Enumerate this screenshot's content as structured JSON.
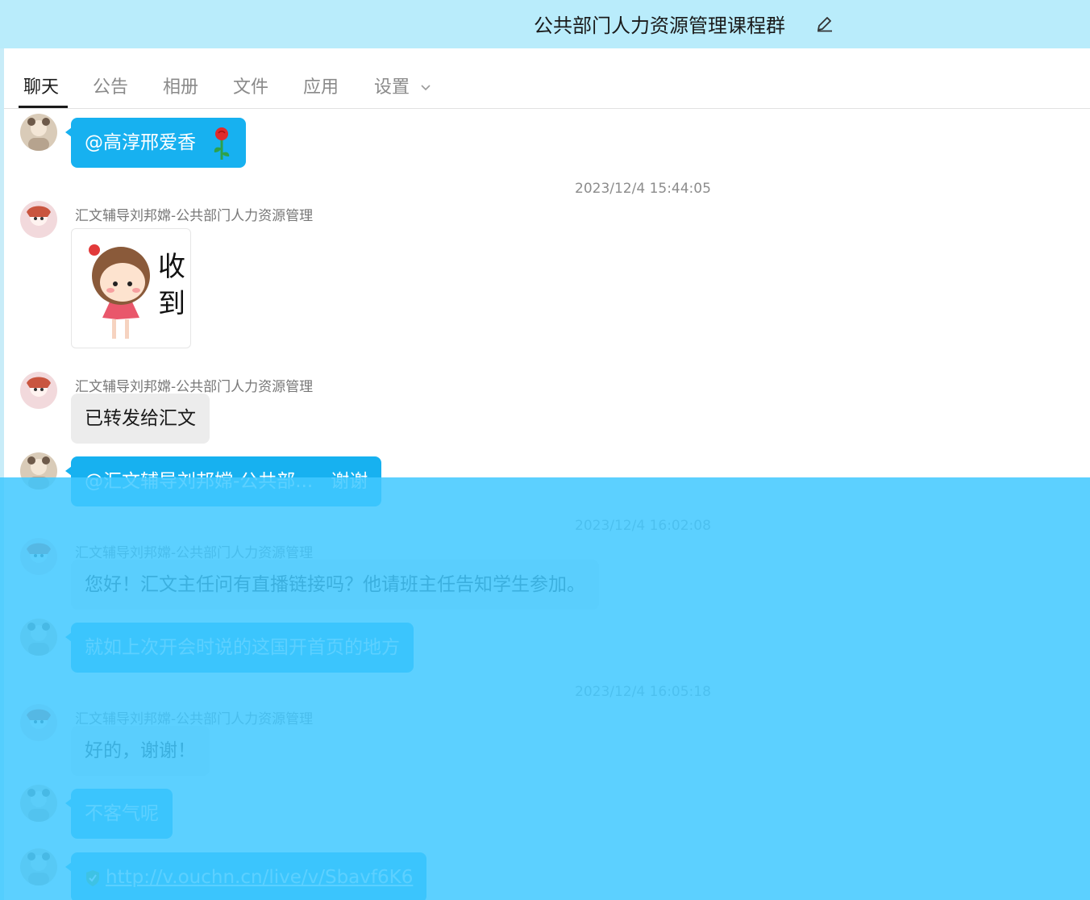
{
  "window": {
    "title": "公共部门人力资源管理课程群",
    "edit_icon": "pencil-icon"
  },
  "tabs": [
    {
      "label": "聊天",
      "active": true
    },
    {
      "label": "公告"
    },
    {
      "label": "相册"
    },
    {
      "label": "文件"
    },
    {
      "label": "应用"
    },
    {
      "label": "设置",
      "has_dropdown": true
    }
  ],
  "messages": {
    "m1": {
      "text": "@高淳邢爱香",
      "emoji": "rose-icon"
    },
    "t1": "2023/12/4 15:44:05",
    "m2": {
      "sender": "汇文辅导刘邦嫦-公共部门人力资源管理",
      "sticker_text": "收到"
    },
    "m3": {
      "sender": "汇文辅导刘邦嫦-公共部门人力资源管理",
      "text": "已转发给汇文"
    },
    "m4": {
      "mention": "@汇文辅导刘邦嫦-公共部...",
      "text": "谢谢"
    },
    "t2": "2023/12/4 16:02:08",
    "m5": {
      "sender": "汇文辅导刘邦嫦-公共部门人力资源管理",
      "text": "您好！汇文主任问有直播链接吗？他请班主任告知学生参加。"
    },
    "m6": {
      "text": "就如上次开会时说的这国开首页的地方"
    },
    "t3": "2023/12/4 16:05:18",
    "m7": {
      "sender": "汇文辅导刘邦嫦-公共部门人力资源管理",
      "text": "好的，谢谢！"
    },
    "m8": {
      "text": "不客气呢"
    },
    "m9": {
      "link": "http://v.ouchn.cn/live/v/Sbavf6K6",
      "icon": "verified-check-icon"
    }
  },
  "colors": {
    "titlebar": "#b9ecfb",
    "bubble_blue": "#17b1f0",
    "bubble_gray": "#ececec",
    "overlay": "#41c8ff"
  }
}
